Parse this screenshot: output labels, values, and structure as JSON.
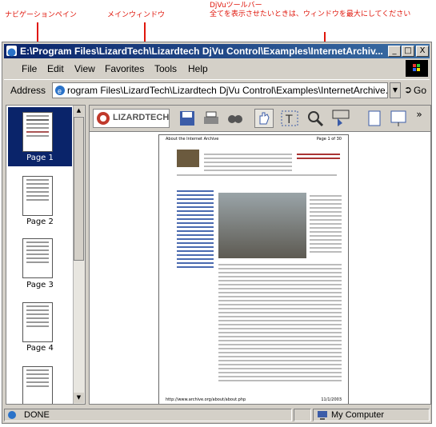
{
  "annotations": {
    "navigation_pane": "ナビゲーションペイン",
    "main_window": "メインウィンドウ",
    "toolbar_title": "DjVuツールバー",
    "toolbar_note": "全てを表示させたいときは、ウィンドウを最大にしてください"
  },
  "window": {
    "title": "E:\\Program Files\\LizardTech\\Lizardtech DjVu Control\\Examples\\InternetArchiv...",
    "minimize": "_",
    "maximize": "□",
    "close": "X"
  },
  "menu": {
    "items": [
      "File",
      "Edit",
      "View",
      "Favorites",
      "Tools",
      "Help"
    ]
  },
  "address": {
    "label": "Address",
    "value": "rogram Files\\LizardTech\\Lizardtech DjVu Control\\Examples\\InternetArchive.djvu",
    "go": "Go"
  },
  "sidebar": {
    "pages": [
      {
        "label": "Page 1"
      },
      {
        "label": "Page 2"
      },
      {
        "label": "Page 3"
      },
      {
        "label": "Page 4"
      }
    ]
  },
  "toolbar": {
    "logo": "LIZARDTECH",
    "icons": [
      "save-icon",
      "print-icon",
      "find-icon",
      "hand-icon",
      "text-select-icon",
      "zoom-icon",
      "rectangle-zoom-icon",
      "single-page-icon",
      "layout-icon",
      "more-icon"
    ]
  },
  "document": {
    "header_left": "About the Internet Archive",
    "header_right": "Page 1 of 30",
    "footer_left": "http://www.archive.org/about/about.php",
    "footer_right": "11/1/2003"
  },
  "status": {
    "text": "DONE",
    "zone": "My Computer"
  },
  "colors": {
    "annotation": "#e0170c",
    "titlebar_start": "#0a246a",
    "titlebar_end": "#3a6ea5",
    "selected_thumb": "#0a246a"
  }
}
